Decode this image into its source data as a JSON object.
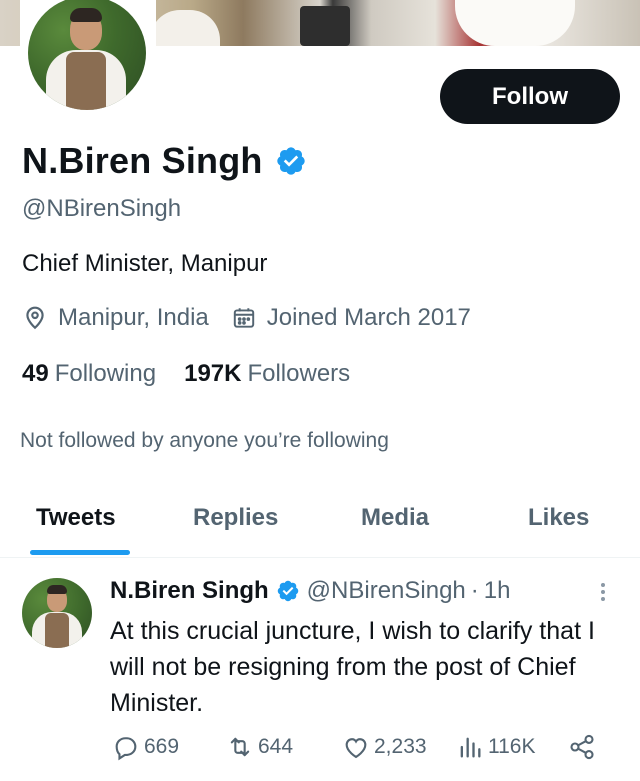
{
  "profile": {
    "display_name": "N.Biren Singh",
    "handle": "@NBirenSingh",
    "bio": "Chief Minister, Manipur",
    "location": "Manipur, India",
    "joined": "Joined March 2017",
    "following_count": "49",
    "following_label": "Following",
    "followers_count": "197K",
    "followers_label": "Followers",
    "not_followed_text": "Not followed by anyone you’re following",
    "follow_button": "Follow",
    "verified_color": "#1d9bf0"
  },
  "tabs": [
    {
      "label": "Tweets",
      "active": true
    },
    {
      "label": "Replies",
      "active": false
    },
    {
      "label": "Media",
      "active": false
    },
    {
      "label": "Likes",
      "active": false
    }
  ],
  "tweet": {
    "author_name": "N.Biren Singh",
    "author_handle": "@NBirenSingh",
    "separator": "·",
    "time": "1h",
    "text": "At this crucial juncture, I wish to clarify that I will not be resigning from the post of Chief Minister.",
    "replies": "669",
    "retweets": "644",
    "likes": "2,233",
    "views": "116K"
  },
  "icons": {
    "location": "location-pin-icon",
    "calendar": "calendar-icon",
    "verified": "verified-badge-icon",
    "reply": "reply-icon",
    "retweet": "retweet-icon",
    "like": "heart-icon",
    "views": "views-chart-icon",
    "share": "share-icon",
    "more": "more-vertical-icon"
  }
}
